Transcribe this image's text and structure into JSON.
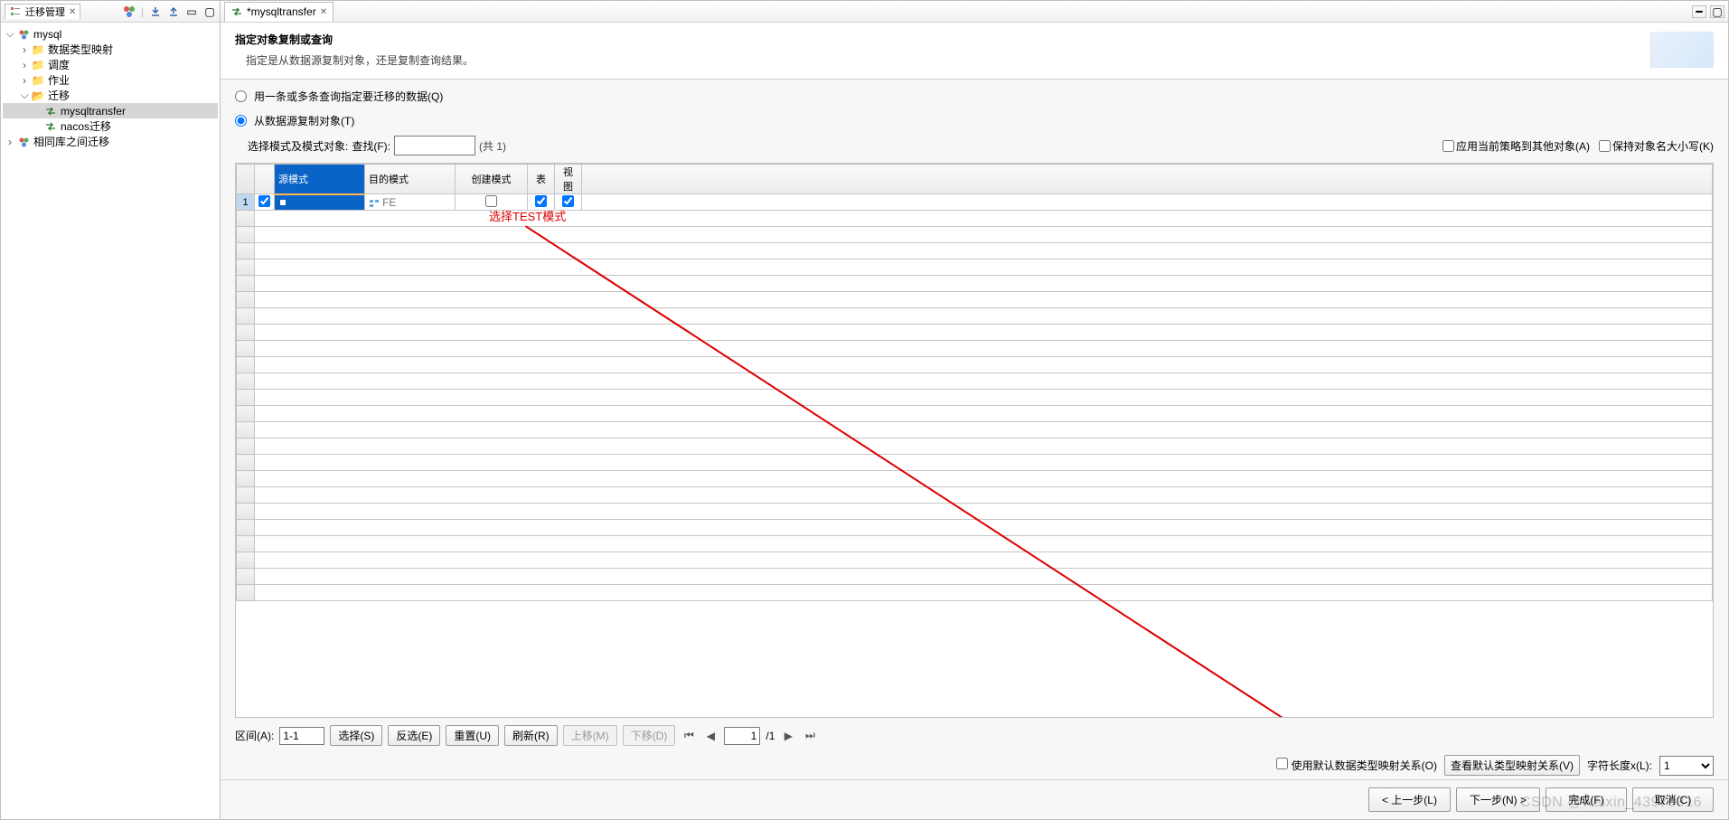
{
  "panel": {
    "title": "迁移管理",
    "tree": {
      "root": {
        "label": "mysql"
      },
      "mapping": {
        "label": "数据类型映射"
      },
      "schedule": {
        "label": "调度"
      },
      "jobs": {
        "label": "作业"
      },
      "migrate": {
        "label": "迁移"
      },
      "item1": {
        "label": "mysqltransfer"
      },
      "item2": {
        "label": "nacos迁移"
      },
      "same": {
        "label": "相同库之间迁移"
      }
    }
  },
  "editor": {
    "tab": "*mysqltransfer",
    "wizard": {
      "title": "指定对象复制或查询",
      "subtitle": "指定是从数据源复制对象，还是复制查询结果。",
      "radio_query": "用一条或多条查询指定要迁移的数据(Q)",
      "radio_copy": "从数据源复制对象(T)",
      "filter_label": "选择模式及模式对象:",
      "search_label": "查找(F):",
      "count_text": "(共 1)",
      "apply_strategy": "应用当前策略到其他对象(A)",
      "keep_case": "保持对象名大小写(K)",
      "annot": "选择TEST模式"
    },
    "grid": {
      "cols": {
        "src": "源模式",
        "dst": "目的模式",
        "create": "创建模式",
        "table": "表",
        "view": "视图"
      },
      "row1": {
        "num": "1",
        "src": "",
        "dst": "FE"
      }
    },
    "toolbar": {
      "range_label": "区间(A):",
      "range_value": "1-1",
      "select": "选择(S)",
      "invert": "反选(E)",
      "reset": "重置(U)",
      "refresh": "刷新(R)",
      "up": "上移(M)",
      "down": "下移(D)",
      "page_cur": "1",
      "page_total": "/1"
    },
    "mapping": {
      "use_default": "使用默认数据类型映射关系(O)",
      "view_default": "查看默认类型映射关系(V)",
      "len_label": "字符长度x(L):",
      "len_value": "1"
    },
    "footer": {
      "prev": "< 上一步(L)",
      "next": "下一步(N) >",
      "finish": "完成(F)",
      "cancel": "取消(C)"
    }
  },
  "watermark": "CSDN @weixin_43975316"
}
